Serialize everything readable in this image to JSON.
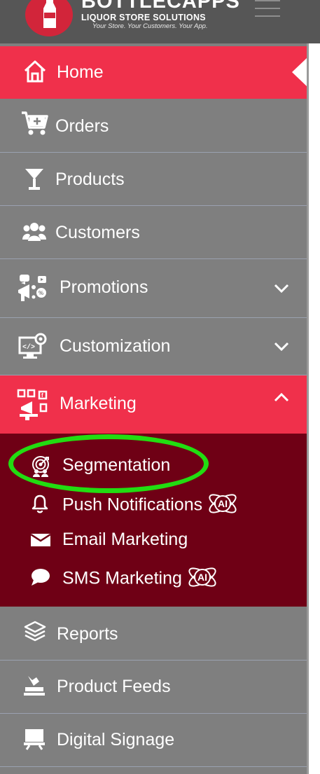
{
  "header": {
    "brand_main": "BOTTLECAPPS",
    "brand_sub": "LIQUOR STORE SOLUTIONS",
    "brand_tagline": "Your Store. Your Customers. Your App."
  },
  "sidebar": {
    "items": [
      {
        "id": "home",
        "label": "Home",
        "icon": "home-icon",
        "active": true
      },
      {
        "id": "orders",
        "label": "Orders",
        "icon": "cart-icon"
      },
      {
        "id": "products",
        "label": "Products",
        "icon": "cocktail-glass-icon"
      },
      {
        "id": "customers",
        "label": "Customers",
        "icon": "users-icon"
      },
      {
        "id": "promotions",
        "label": "Promotions",
        "icon": "megaphone-icon",
        "expandable": true
      },
      {
        "id": "customization",
        "label": "Customization",
        "icon": "monitor-settings-icon",
        "expandable": true
      },
      {
        "id": "marketing",
        "label": "Marketing",
        "icon": "marketing-icon",
        "expanded": true
      },
      {
        "id": "reports",
        "label": "Reports",
        "icon": "layers-icon"
      },
      {
        "id": "product_feeds",
        "label": "Product Feeds",
        "icon": "feed-icon"
      },
      {
        "id": "digital_signage",
        "label": "Digital Signage",
        "icon": "signage-icon"
      }
    ],
    "marketing_submenu": [
      {
        "label": "Segmentation",
        "icon": "target-users-icon",
        "highlighted": true
      },
      {
        "label": "Push Notifications",
        "icon": "bell-icon",
        "ai_badge": "AI"
      },
      {
        "label": "Email Marketing",
        "icon": "envelope-icon"
      },
      {
        "label": "SMS Marketing",
        "icon": "chat-bubble-icon",
        "ai_badge": "AI"
      }
    ]
  },
  "colors": {
    "header_bg": "#565656",
    "sidebar_bg": "#7f7f7f",
    "active_bg": "#f0304b",
    "submenu_bg": "#6f0015",
    "highlight": "#22dd11"
  }
}
